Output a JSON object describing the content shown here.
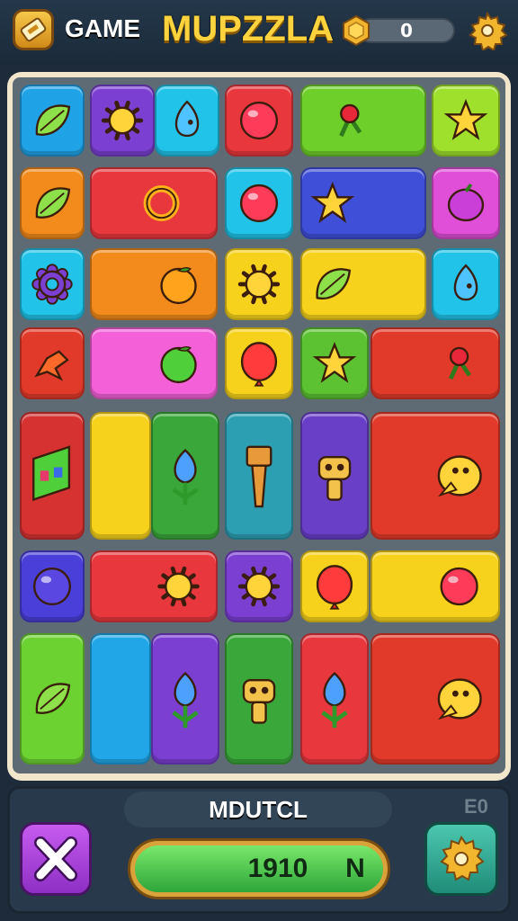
{
  "header": {
    "game_label": "GAME",
    "title": "MUPZZLA",
    "coins": "0"
  },
  "board": {
    "tiles": [
      {
        "color": "#1fa3e6",
        "icon": "leaf-icon"
      },
      {
        "color": "#7b3fd1",
        "icon": "sun-icon"
      },
      {
        "color": "#21c3e8",
        "icon": "drop-icon"
      },
      {
        "color": "#e8383e",
        "icon": "ball-icon"
      },
      {
        "color": "#6fcf2a",
        "icon": "cherry-icon"
      },
      {
        "color": "#9ee02c",
        "icon": "star-icon"
      },
      {
        "color": "#f28a1c",
        "icon": "leaf-icon"
      },
      {
        "color": "#e8383e",
        "icon": "ring-icon"
      },
      {
        "color": "#21c3e8",
        "icon": "ball-icon"
      },
      {
        "color": "#3f4fd8",
        "icon": "star-icon"
      },
      {
        "color": "#e04fd8",
        "icon": "berry-icon"
      },
      {
        "color": "#21c3e8",
        "icon": "gear-icon"
      },
      {
        "color": "#f28a1c",
        "icon": "orange-icon"
      },
      {
        "color": "#f6d21c",
        "icon": "sun-icon"
      },
      {
        "color": "#f6d21c",
        "icon": "leaf-icon"
      },
      {
        "color": "#21c3e8",
        "icon": "drop-icon"
      },
      {
        "color": "#e23a2a",
        "icon": "bird-icon"
      },
      {
        "color": "#f460d8",
        "icon": "apple-icon"
      },
      {
        "color": "#f6d21c",
        "icon": "balloon-icon"
      },
      {
        "color": "#5cc232",
        "icon": "star-icon"
      },
      {
        "color": "#e23a2a",
        "icon": "cherry-icon"
      },
      {
        "color": "#d63232",
        "icon": "flag-icon"
      },
      {
        "color": "#f6d21c",
        "icon": "none"
      },
      {
        "color": "#3aa73a",
        "icon": "flower-icon"
      },
      {
        "color": "#2d9fb3",
        "icon": "hammer-icon"
      },
      {
        "color": "#6a3fc8",
        "icon": "robot-icon"
      },
      {
        "color": "#e23a2a",
        "icon": "chick-icon"
      },
      {
        "color": "#4a3fd8",
        "icon": "orb-icon"
      },
      {
        "color": "#e8383e",
        "icon": "sun-icon"
      },
      {
        "color": "#7b3fd1",
        "icon": "sun-icon"
      },
      {
        "color": "#f6d21c",
        "icon": "balloon-icon"
      },
      {
        "color": "#f6d21c",
        "icon": "ball-icon"
      },
      {
        "color": "#6cd232",
        "icon": "leaf-icon"
      },
      {
        "color": "#21a6e8",
        "icon": "none"
      },
      {
        "color": "#7b3fd1",
        "icon": "flower-icon"
      },
      {
        "color": "#3aa73a",
        "icon": "robot-icon"
      },
      {
        "color": "#e8383e",
        "icon": "flower-icon"
      },
      {
        "color": "#e23a2a",
        "icon": "chick-icon"
      }
    ]
  },
  "footer": {
    "mode_label": "MDUTCL",
    "corner_label": "E0",
    "score": "1910",
    "score_unit": "N"
  },
  "icons": {
    "logo": "ticket-icon",
    "coin": "coin-icon",
    "settings_top": "gear-icon",
    "close": "close-icon",
    "settings_bottom": "gear-icon"
  }
}
